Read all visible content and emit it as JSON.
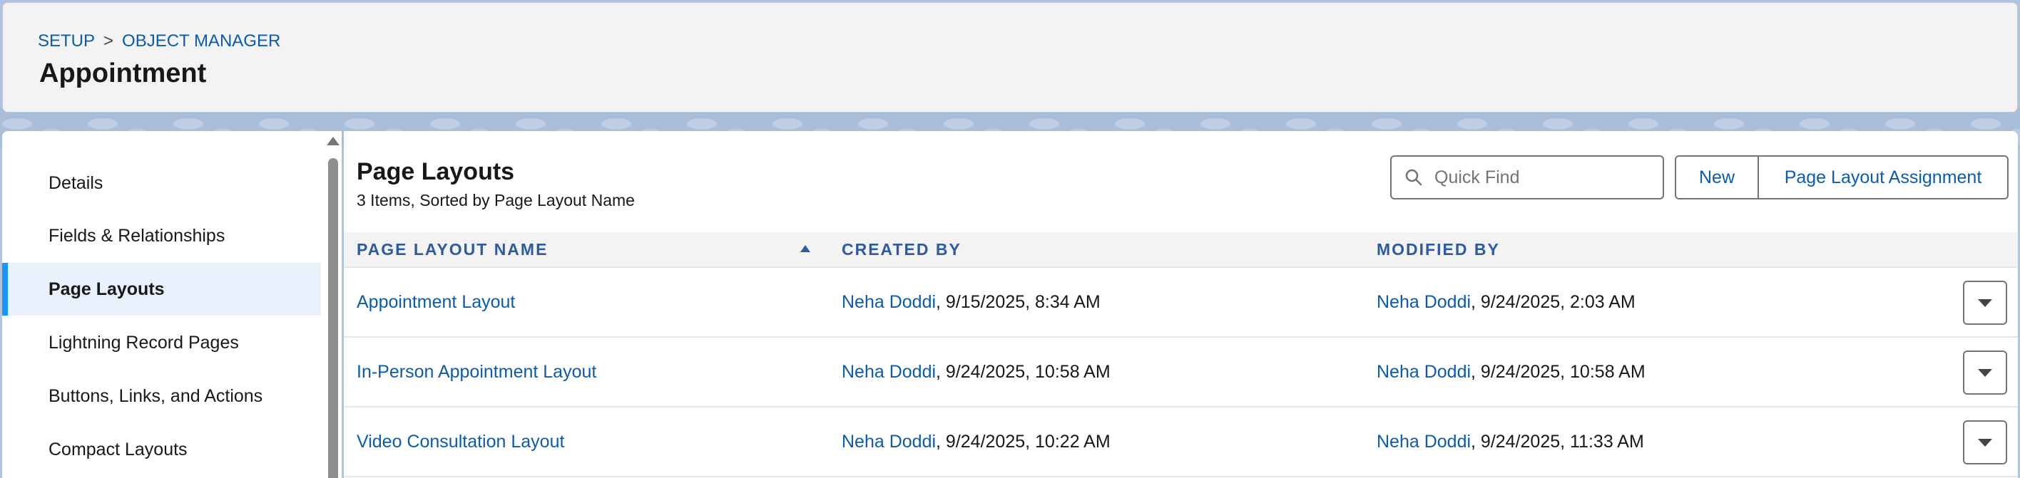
{
  "breadcrumb": {
    "setup": "SETUP",
    "separator": ">",
    "object_manager": "OBJECT MANAGER"
  },
  "page_title": "Appointment",
  "sidebar": {
    "items": [
      {
        "label": "Details",
        "active": false
      },
      {
        "label": "Fields & Relationships",
        "active": false
      },
      {
        "label": "Page Layouts",
        "active": true
      },
      {
        "label": "Lightning Record Pages",
        "active": false
      },
      {
        "label": "Buttons, Links, and Actions",
        "active": false
      },
      {
        "label": "Compact Layouts",
        "active": false
      }
    ]
  },
  "main": {
    "title": "Page Layouts",
    "subtitle": "3 Items, Sorted by Page Layout Name",
    "search": {
      "placeholder": "Quick Find",
      "value": ""
    },
    "buttons": {
      "new": "New",
      "assignment": "Page Layout Assignment"
    },
    "columns": [
      "PAGE LAYOUT NAME",
      "CREATED BY",
      "MODIFIED BY"
    ],
    "rows": [
      {
        "name": "Appointment Layout",
        "created_user": "Neha Doddi",
        "created_date": ", 9/15/2025, 8:34 AM",
        "modified_user": "Neha Doddi",
        "modified_date": ", 9/24/2025, 2:03 AM"
      },
      {
        "name": "In-Person Appointment Layout",
        "created_user": "Neha Doddi",
        "created_date": ", 9/24/2025, 10:58 AM",
        "modified_user": "Neha Doddi",
        "modified_date": ", 9/24/2025, 10:58 AM"
      },
      {
        "name": "Video Consultation Layout",
        "created_user": "Neha Doddi",
        "created_date": ", 9/24/2025, 10:22 AM",
        "modified_user": "Neha Doddi",
        "modified_date": ", 9/24/2025, 11:33 AM"
      }
    ]
  },
  "colors": {
    "link": "#0b5cab",
    "active_nav_bg": "#e9f1fc",
    "active_nav_bar": "#1b96ff",
    "header_text": "#2e5aa0"
  },
  "icons": {
    "search": "search-icon",
    "sort": "sort-ascending-icon",
    "row_menu": "chevron-down-icon"
  }
}
